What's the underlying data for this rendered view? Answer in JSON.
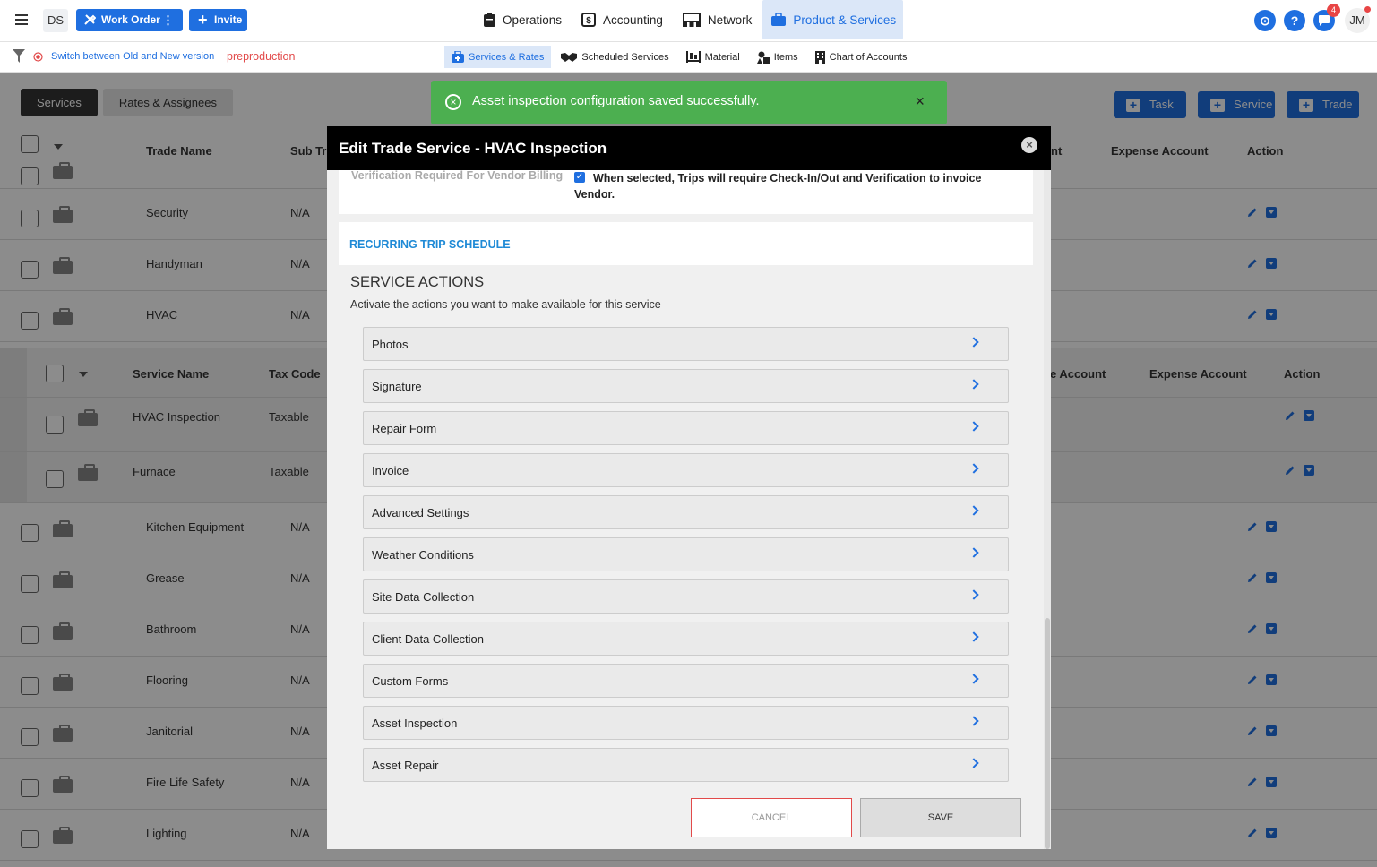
{
  "topbar": {
    "ds": "DS",
    "work_order": "Work Order",
    "work_order_more": "⋮",
    "invite": "Invite",
    "nav": [
      {
        "label": "Operations",
        "icon": "clipboard-icon"
      },
      {
        "label": "Accounting",
        "icon": "dollar-icon"
      },
      {
        "label": "Network",
        "icon": "network-icon"
      },
      {
        "label": "Product & Services",
        "icon": "briefcase-icon",
        "active": true
      }
    ],
    "notification_count": "4",
    "avatar": "JM",
    "help": "?"
  },
  "subbar": {
    "switch_link": "Switch between Old and New version",
    "env": "preproduction",
    "items": [
      {
        "label": "Services & Rates",
        "active": true
      },
      {
        "label": "Scheduled Services"
      },
      {
        "label": "Material"
      },
      {
        "label": "Items"
      },
      {
        "label": "Chart of Accounts"
      }
    ]
  },
  "page": {
    "tabs": [
      "Services",
      "Rates & Assignees"
    ],
    "buttons": [
      "Task",
      "Service",
      "Trade"
    ],
    "headers": {
      "trade_name": "Trade Name",
      "sub_trade": "Sub Tr",
      "income_account_tail": "nt",
      "expense_account": "Expense Account",
      "action": "Action"
    },
    "sub_headers": {
      "service_name": "Service Name",
      "tax_code": "Tax Code",
      "income_account_tail": "e Account",
      "expense_account": "Expense Account",
      "action": "Action"
    },
    "rows_top": [
      {
        "name": "Security",
        "sub": "N/A"
      },
      {
        "name": "Handyman",
        "sub": "N/A"
      },
      {
        "name": "HVAC",
        "sub": "N/A"
      }
    ],
    "sub_rows": [
      {
        "name": "HVAC Inspection",
        "tax": "Taxable"
      },
      {
        "name": "Furnace",
        "tax": "Taxable"
      }
    ],
    "rows_bottom": [
      {
        "name": "Kitchen Equipment",
        "sub": "N/A"
      },
      {
        "name": "Grease",
        "sub": "N/A"
      },
      {
        "name": "Bathroom",
        "sub": "N/A"
      },
      {
        "name": "Flooring",
        "sub": "N/A"
      },
      {
        "name": "Janitorial",
        "sub": "N/A"
      },
      {
        "name": "Fire Life Safety",
        "sub": "N/A"
      },
      {
        "name": "Lighting",
        "sub": "N/A"
      }
    ]
  },
  "toast": {
    "message": "Asset inspection configuration saved successfully.",
    "close": "×"
  },
  "modal": {
    "title": "Edit Trade Service - HVAC Inspection",
    "verification_label": "Verification Required For Vendor Billing",
    "verification_text": "When selected, Trips will require Check-In/Out and Verification to invoice Vendor.",
    "verification_checked": true,
    "recurring": "RECURRING TRIP SCHEDULE",
    "service_actions_title": "SERVICE ACTIONS",
    "service_actions_sub": "Activate the actions you want to make available for this service",
    "actions": [
      "Photos",
      "Signature",
      "Repair Form",
      "Invoice",
      "Advanced Settings",
      "Weather Conditions",
      "Site Data Collection",
      "Client Data Collection",
      "Custom Forms",
      "Asset Inspection",
      "Asset Repair"
    ],
    "cancel": "CANCEL",
    "save": "SAVE"
  },
  "colors": {
    "accent": "#1f6fe0",
    "success": "#4caf50",
    "danger": "#e24a4a"
  }
}
